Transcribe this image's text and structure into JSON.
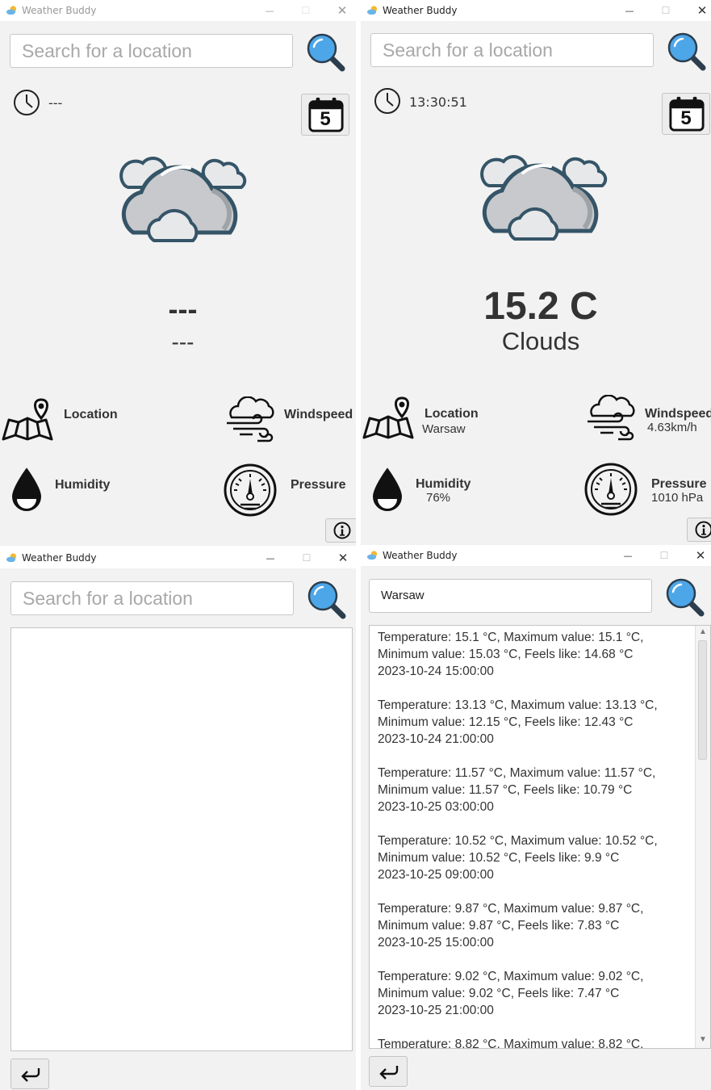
{
  "app": {
    "title": "Weather Buddy"
  },
  "window_controls": {
    "minimize": "—",
    "maximize": "☐",
    "close": "✕"
  },
  "colors": {
    "search_icon": "#4da6e8",
    "cloud_fill": "#c7c9cc",
    "cloud_outline": "#355467",
    "background": "#f2f2f2"
  },
  "icons": [
    "app-weather-icon",
    "search-icon",
    "clock-icon",
    "calendar-5-icon",
    "clouds-icon",
    "map-pin-icon",
    "wind-icon",
    "water-drop-icon",
    "gauge-icon",
    "info-icon",
    "back-arrow-icon"
  ],
  "panel1": {
    "search": {
      "placeholder": "Search for a location"
    },
    "time": "---",
    "calendar_day": "5",
    "temperature": "---",
    "description": "---",
    "location": {
      "label": "Location",
      "value": ""
    },
    "windspeed": {
      "label": "Windspeed",
      "value": ""
    },
    "humidity": {
      "label": "Humidity",
      "value": ""
    },
    "pressure": {
      "label": "Pressure",
      "value": ""
    }
  },
  "panel2": {
    "search": {
      "placeholder": "Search for a location"
    },
    "time": "13:30:51",
    "calendar_day": "5",
    "temperature": "15.2 C",
    "description": "Clouds",
    "location": {
      "label": "Location",
      "value": "Warsaw"
    },
    "windspeed": {
      "label": "Windspeed",
      "value": "4.63km/h"
    },
    "humidity": {
      "label": "Humidity",
      "value": "76%"
    },
    "pressure": {
      "label": "Pressure",
      "value": "1010 hPa"
    }
  },
  "panel3": {
    "search": {
      "placeholder": "Search for a location"
    }
  },
  "panel4": {
    "search": {
      "value": "Warsaw"
    },
    "forecast": [
      {
        "line1": "Temperature: 15.1 °C, Maximum value: 15.1 °C,",
        "line2": "Minimum value: 15.03 °C, Feels like: 14.68 °C",
        "datetime": "2023-10-24 15:00:00"
      },
      {
        "line1": "Temperature: 13.13 °C, Maximum value: 13.13 °C,",
        "line2": "Minimum value: 12.15 °C, Feels like: 12.43 °C",
        "datetime": "2023-10-24 21:00:00"
      },
      {
        "line1": "Temperature: 11.57 °C, Maximum value: 11.57 °C,",
        "line2": "Minimum value: 11.57 °C, Feels like: 10.79 °C",
        "datetime": "2023-10-25 03:00:00"
      },
      {
        "line1": "Temperature: 10.52 °C, Maximum value: 10.52 °C,",
        "line2": "Minimum value: 10.52 °C, Feels like: 9.9 °C",
        "datetime": "2023-10-25 09:00:00"
      },
      {
        "line1": "Temperature: 9.87 °C, Maximum value: 9.87 °C,",
        "line2": "Minimum value: 9.87 °C, Feels like: 7.83 °C",
        "datetime": "2023-10-25 15:00:00"
      },
      {
        "line1": "Temperature: 9.02 °C, Maximum value: 9.02 °C,",
        "line2": "Minimum value: 9.02 °C, Feels like: 7.47 °C",
        "datetime": "2023-10-25 21:00:00"
      },
      {
        "line1": "Temperature: 8.82 °C, Maximum value: 8.82 °C,",
        "line2": "",
        "datetime": ""
      }
    ]
  }
}
